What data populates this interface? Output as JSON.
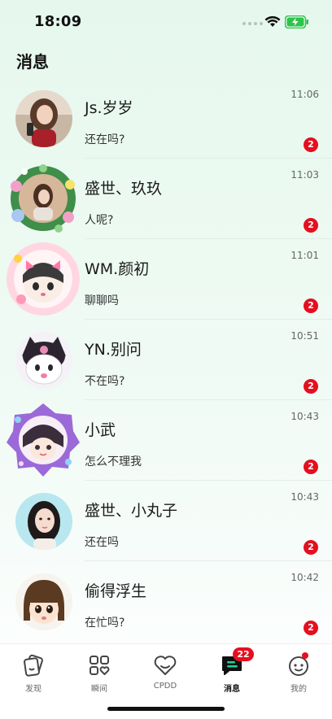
{
  "status_bar": {
    "time": "18:09",
    "icons": [
      "signal-dots-icon",
      "wifi-icon",
      "battery-charging-icon"
    ],
    "battery_color": "#2ec44a"
  },
  "header": {
    "title": "消息"
  },
  "conversations": [
    {
      "name": "Js.岁岁",
      "message": "还在吗?",
      "time": "11:06",
      "unread": "2",
      "avatar": "avatar-photo-girl"
    },
    {
      "name": "盛世、玖玖",
      "message": "人呢?",
      "time": "11:03",
      "unread": "2",
      "avatar": "avatar-flower-frame"
    },
    {
      "name": "WM.颜初",
      "message": "聊聊吗",
      "time": "11:01",
      "unread": "2",
      "avatar": "avatar-pink-bunny-cartoon"
    },
    {
      "name": "YN.别问",
      "message": "不在吗?",
      "time": "10:51",
      "unread": "2",
      "avatar": "avatar-kuromi-cartoon"
    },
    {
      "name": "小武",
      "message": "怎么不理我",
      "time": "10:43",
      "unread": "2",
      "avatar": "avatar-purple-frame-cartoon"
    },
    {
      "name": "盛世、小丸子",
      "message": "还在吗",
      "time": "10:43",
      "unread": "2",
      "avatar": "avatar-photo-girl-2"
    },
    {
      "name": "偷得浮生",
      "message": "在忙吗?",
      "time": "10:42",
      "unread": "2",
      "avatar": "avatar-bob-hair-cartoon"
    }
  ],
  "tabbar": {
    "tabs": [
      {
        "label": "发现",
        "icon": "discover-cards-icon"
      },
      {
        "label": "瞬间",
        "icon": "moments-grid-icon"
      },
      {
        "label": "CPDD",
        "icon": "heart-icon"
      },
      {
        "label": "消息",
        "icon": "message-chat-icon",
        "badge": "22",
        "active": true
      },
      {
        "label": "我的",
        "icon": "profile-face-icon",
        "dot": true
      }
    ]
  },
  "colors": {
    "badge": "#e50f1f",
    "background_top": "#e6f8ee",
    "accent_green": "#20d39a"
  }
}
